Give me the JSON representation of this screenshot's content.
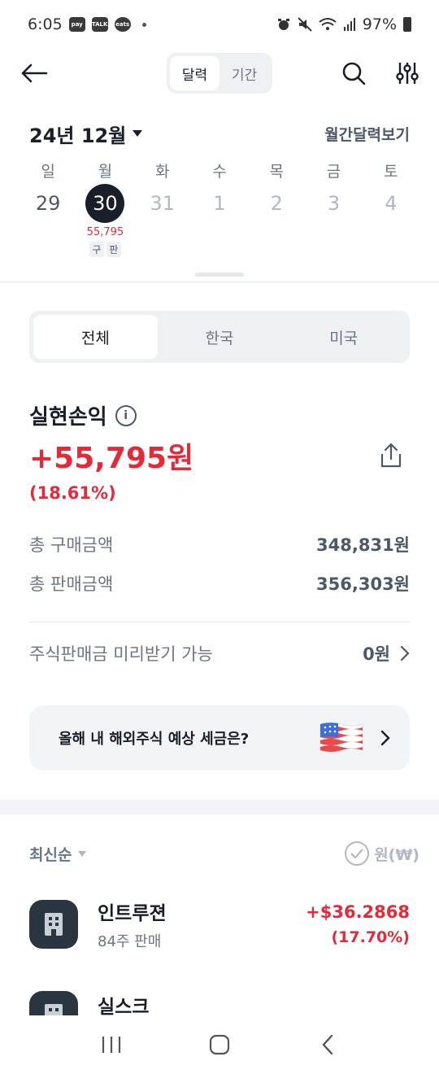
{
  "status": {
    "time": "6:05",
    "battery": "97%",
    "icons": [
      "pay-icon",
      "talk-icon",
      "eats-icon",
      "alarm-icon",
      "mute-icon",
      "wifi-icon",
      "signal-icon",
      "battery-icon"
    ]
  },
  "topbar": {
    "tabs": [
      {
        "label": "달력"
      },
      {
        "label": "기간"
      }
    ],
    "active_tab": "달력"
  },
  "calendar": {
    "month": "24년 12월",
    "monthly_view": "월간달력보기",
    "days": [
      {
        "dow": "일",
        "date": "29"
      },
      {
        "dow": "월",
        "date": "30",
        "amount": "55,795",
        "tags": [
          "구",
          "판"
        ]
      },
      {
        "dow": "화",
        "date": "31"
      },
      {
        "dow": "수",
        "date": "1"
      },
      {
        "dow": "목",
        "date": "2"
      },
      {
        "dow": "금",
        "date": "3"
      },
      {
        "dow": "토",
        "date": "4"
      }
    ]
  },
  "market_tabs": [
    {
      "label": "전체"
    },
    {
      "label": "한국"
    },
    {
      "label": "미국"
    }
  ],
  "summary": {
    "title": "실현손익",
    "amount": "+55,795원",
    "rate": "(18.61%)",
    "rows": [
      {
        "label": "총 구매금액",
        "value": "348,831원"
      },
      {
        "label": "총 판매금액",
        "value": "356,303원"
      }
    ],
    "prepay": {
      "label": "주식판매금 미리받기 가능",
      "value": "0원"
    }
  },
  "tax_card": {
    "text": "올해 내 해외주식 예상 세금은?"
  },
  "list": {
    "sort_label": "최신순",
    "currency_label": "원(₩)",
    "items": [
      {
        "name": "인트루젼",
        "sub": "84주 판매",
        "profit": "+$36.2868",
        "rate": "(17.70%)"
      },
      {
        "name": "실스크"
      }
    ]
  },
  "colors": {
    "red": "#e42939",
    "dark": "#191f28",
    "gray": "#6b7684",
    "bg_gray": "#f2f4f6"
  }
}
